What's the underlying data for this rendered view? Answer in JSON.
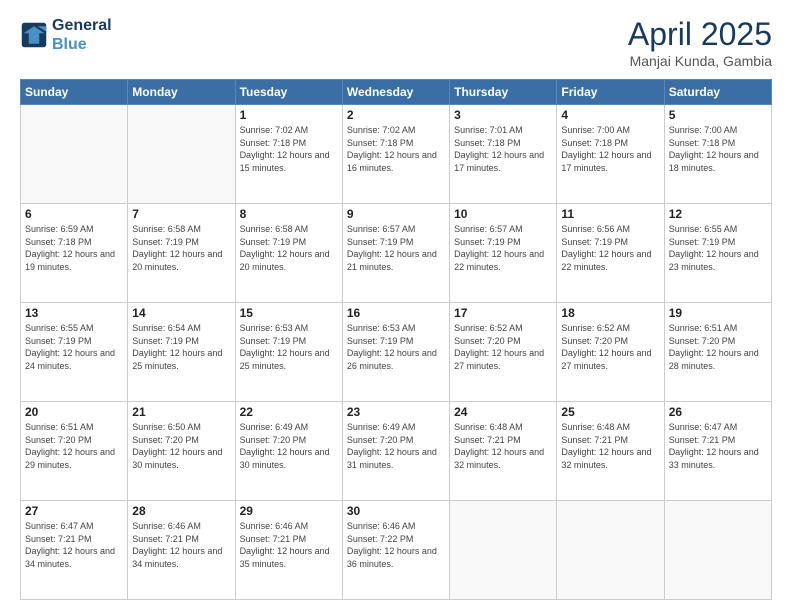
{
  "header": {
    "logo_line1": "General",
    "logo_line2": "Blue",
    "title": "April 2025",
    "subtitle": "Manjai Kunda, Gambia"
  },
  "columns": [
    "Sunday",
    "Monday",
    "Tuesday",
    "Wednesday",
    "Thursday",
    "Friday",
    "Saturday"
  ],
  "weeks": [
    [
      {
        "day": "",
        "info": ""
      },
      {
        "day": "",
        "info": ""
      },
      {
        "day": "1",
        "info": "Sunrise: 7:02 AM\nSunset: 7:18 PM\nDaylight: 12 hours and 15 minutes."
      },
      {
        "day": "2",
        "info": "Sunrise: 7:02 AM\nSunset: 7:18 PM\nDaylight: 12 hours and 16 minutes."
      },
      {
        "day": "3",
        "info": "Sunrise: 7:01 AM\nSunset: 7:18 PM\nDaylight: 12 hours and 17 minutes."
      },
      {
        "day": "4",
        "info": "Sunrise: 7:00 AM\nSunset: 7:18 PM\nDaylight: 12 hours and 17 minutes."
      },
      {
        "day": "5",
        "info": "Sunrise: 7:00 AM\nSunset: 7:18 PM\nDaylight: 12 hours and 18 minutes."
      }
    ],
    [
      {
        "day": "6",
        "info": "Sunrise: 6:59 AM\nSunset: 7:18 PM\nDaylight: 12 hours and 19 minutes."
      },
      {
        "day": "7",
        "info": "Sunrise: 6:58 AM\nSunset: 7:19 PM\nDaylight: 12 hours and 20 minutes."
      },
      {
        "day": "8",
        "info": "Sunrise: 6:58 AM\nSunset: 7:19 PM\nDaylight: 12 hours and 20 minutes."
      },
      {
        "day": "9",
        "info": "Sunrise: 6:57 AM\nSunset: 7:19 PM\nDaylight: 12 hours and 21 minutes."
      },
      {
        "day": "10",
        "info": "Sunrise: 6:57 AM\nSunset: 7:19 PM\nDaylight: 12 hours and 22 minutes."
      },
      {
        "day": "11",
        "info": "Sunrise: 6:56 AM\nSunset: 7:19 PM\nDaylight: 12 hours and 22 minutes."
      },
      {
        "day": "12",
        "info": "Sunrise: 6:55 AM\nSunset: 7:19 PM\nDaylight: 12 hours and 23 minutes."
      }
    ],
    [
      {
        "day": "13",
        "info": "Sunrise: 6:55 AM\nSunset: 7:19 PM\nDaylight: 12 hours and 24 minutes."
      },
      {
        "day": "14",
        "info": "Sunrise: 6:54 AM\nSunset: 7:19 PM\nDaylight: 12 hours and 25 minutes."
      },
      {
        "day": "15",
        "info": "Sunrise: 6:53 AM\nSunset: 7:19 PM\nDaylight: 12 hours and 25 minutes."
      },
      {
        "day": "16",
        "info": "Sunrise: 6:53 AM\nSunset: 7:19 PM\nDaylight: 12 hours and 26 minutes."
      },
      {
        "day": "17",
        "info": "Sunrise: 6:52 AM\nSunset: 7:20 PM\nDaylight: 12 hours and 27 minutes."
      },
      {
        "day": "18",
        "info": "Sunrise: 6:52 AM\nSunset: 7:20 PM\nDaylight: 12 hours and 27 minutes."
      },
      {
        "day": "19",
        "info": "Sunrise: 6:51 AM\nSunset: 7:20 PM\nDaylight: 12 hours and 28 minutes."
      }
    ],
    [
      {
        "day": "20",
        "info": "Sunrise: 6:51 AM\nSunset: 7:20 PM\nDaylight: 12 hours and 29 minutes."
      },
      {
        "day": "21",
        "info": "Sunrise: 6:50 AM\nSunset: 7:20 PM\nDaylight: 12 hours and 30 minutes."
      },
      {
        "day": "22",
        "info": "Sunrise: 6:49 AM\nSunset: 7:20 PM\nDaylight: 12 hours and 30 minutes."
      },
      {
        "day": "23",
        "info": "Sunrise: 6:49 AM\nSunset: 7:20 PM\nDaylight: 12 hours and 31 minutes."
      },
      {
        "day": "24",
        "info": "Sunrise: 6:48 AM\nSunset: 7:21 PM\nDaylight: 12 hours and 32 minutes."
      },
      {
        "day": "25",
        "info": "Sunrise: 6:48 AM\nSunset: 7:21 PM\nDaylight: 12 hours and 32 minutes."
      },
      {
        "day": "26",
        "info": "Sunrise: 6:47 AM\nSunset: 7:21 PM\nDaylight: 12 hours and 33 minutes."
      }
    ],
    [
      {
        "day": "27",
        "info": "Sunrise: 6:47 AM\nSunset: 7:21 PM\nDaylight: 12 hours and 34 minutes."
      },
      {
        "day": "28",
        "info": "Sunrise: 6:46 AM\nSunset: 7:21 PM\nDaylight: 12 hours and 34 minutes."
      },
      {
        "day": "29",
        "info": "Sunrise: 6:46 AM\nSunset: 7:21 PM\nDaylight: 12 hours and 35 minutes."
      },
      {
        "day": "30",
        "info": "Sunrise: 6:46 AM\nSunset: 7:22 PM\nDaylight: 12 hours and 36 minutes."
      },
      {
        "day": "",
        "info": ""
      },
      {
        "day": "",
        "info": ""
      },
      {
        "day": "",
        "info": ""
      }
    ]
  ]
}
